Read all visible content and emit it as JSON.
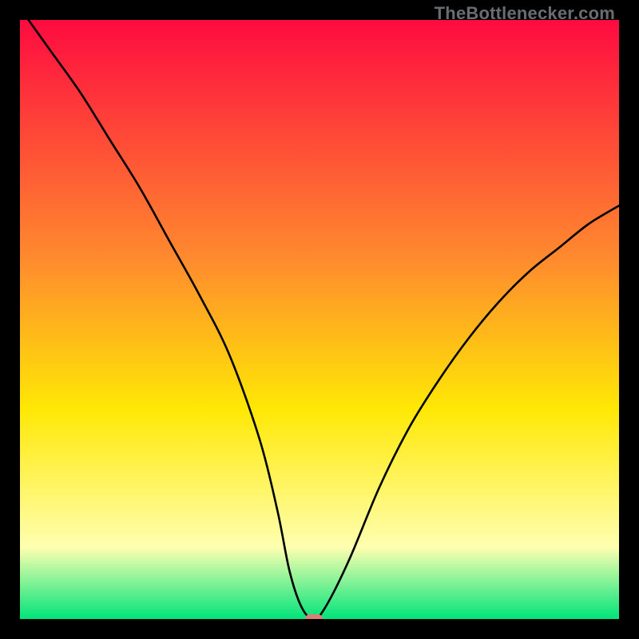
{
  "watermark": "TheBottlenecker.com",
  "colors": {
    "frame": "#000000",
    "gradient_top": "#fe0b40",
    "gradient_mid1": "#ff8b2e",
    "gradient_mid2": "#ffe805",
    "gradient_soft": "#ffffb0",
    "gradient_bottom": "#00e47a",
    "curve": "#000000",
    "marker": "#d68076"
  },
  "chart_data": {
    "type": "line",
    "title": "",
    "xlabel": "",
    "ylabel": "",
    "xlim": [
      0,
      100
    ],
    "ylim": [
      0,
      100
    ],
    "series": [
      {
        "name": "bottleneck-curve",
        "x": [
          0,
          5,
          10,
          15,
          20,
          25,
          30,
          35,
          40,
          43,
          45,
          47,
          49,
          51,
          55,
          60,
          65,
          70,
          75,
          80,
          85,
          90,
          95,
          100
        ],
        "values": [
          102,
          95,
          88,
          80,
          72,
          63,
          54,
          44,
          30,
          18,
          8,
          2,
          0,
          2,
          10,
          22,
          32,
          40,
          47,
          53,
          58,
          62,
          66,
          69
        ]
      }
    ],
    "annotations": [
      {
        "name": "optimal-marker",
        "x": 49,
        "y": 0
      }
    ],
    "background_gradient": [
      {
        "stop": 0.0,
        "key": "gradient_top"
      },
      {
        "stop": 0.4,
        "key": "gradient_mid1"
      },
      {
        "stop": 0.65,
        "key": "gradient_mid2"
      },
      {
        "stop": 0.88,
        "key": "gradient_soft"
      },
      {
        "stop": 1.0,
        "key": "gradient_bottom"
      }
    ]
  }
}
